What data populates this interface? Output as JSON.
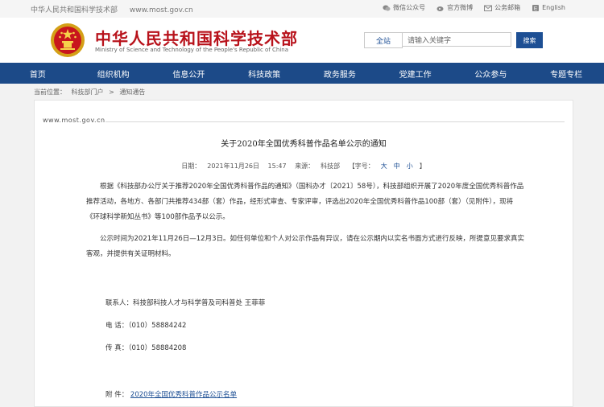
{
  "topbar": {
    "site_name": "中华人民共和国科学技术部",
    "site_url": "www.most.gov.cn",
    "wechat": "微信公众号",
    "weibo": "官方微博",
    "email": "公务邮箱",
    "english": "English"
  },
  "header": {
    "title": "中华人民共和国科学技术部",
    "subtitle": "Ministry of Science and Technology of the People's Republic of China"
  },
  "search": {
    "scope": "全站",
    "placeholder": "请输入关键字",
    "button": "搜索"
  },
  "nav": [
    "首页",
    "组织机构",
    "信息公开",
    "科技政策",
    "政务服务",
    "党建工作",
    "公众参与",
    "专题专栏"
  ],
  "breadcrumb": {
    "label": "当前位置：",
    "item1": "科技部门户",
    "sep": ">",
    "item2": "通知通告"
  },
  "article": {
    "domain": "www.most.gov.cn",
    "title": "关于2020年全国优秀科普作品名单公示的通知",
    "date_label": "日期：",
    "date": "2021年11月26日",
    "time": "15:47",
    "source_label": "来源：",
    "source": "科技部",
    "size_label": "【字号：",
    "size_large": "大",
    "size_medium": "中",
    "size_small": "小",
    "size_end": "】",
    "para1": "根据《科技部办公厅关于推荐2020年全国优秀科普作品的通知》（国科办才〔2021〕58号），科技部组织开展了2020年度全国优秀科普作品推荐活动，各地方、各部门共推荐434部（套）作品，经形式审查、专家评审，评选出2020年全国优秀科普作品100部（套）（见附件），现将《环球科学新知丛书》等100部作品予以公示。",
    "para2": "公示时间为2021年11月26日—12月3日。如任何单位和个人对公示作品有异议，请在公示期内以实名书面方式进行反映，所提意见要求真实客观，并提供有关证明材料。",
    "contact": "联系人：科技部科技人才与科学普及司科普处 王菲菲",
    "phone": "电  话：（010）58884242",
    "fax": "传  真：（010）58884208",
    "attach_label": "附  件：",
    "attach_link": "2020年全国优秀科普作品公示名单"
  }
}
